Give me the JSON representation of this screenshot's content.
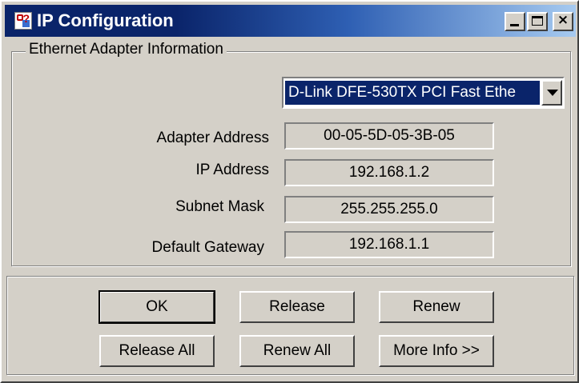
{
  "window": {
    "title": "IP Configuration",
    "title_bar_colors": {
      "start": "#0a246a",
      "end": "#a6caf0"
    },
    "controls": {
      "minimize_icon": "minimize-icon",
      "maximize_icon": "maximize-icon",
      "close_icon": "close-icon",
      "close_glyph": "×"
    }
  },
  "adapter_group": {
    "legend": "Ethernet  Adapter Information",
    "adapter_select": {
      "selected": "D-Link DFE-530TX PCI Fast Ethe"
    },
    "fields": [
      {
        "label": "Adapter Address",
        "value": "00-05-5D-05-3B-05"
      },
      {
        "label": "IP Address",
        "value": "192.168.1.2"
      },
      {
        "label": "Subnet Mask",
        "value": "255.255.255.0"
      },
      {
        "label": "Default Gateway",
        "value": "192.168.1.1"
      }
    ]
  },
  "buttons": {
    "ok": "OK",
    "release": "Release",
    "renew": "Renew",
    "release_all": "Release All",
    "renew_all": "Renew All",
    "more_info": "More Info >>"
  }
}
